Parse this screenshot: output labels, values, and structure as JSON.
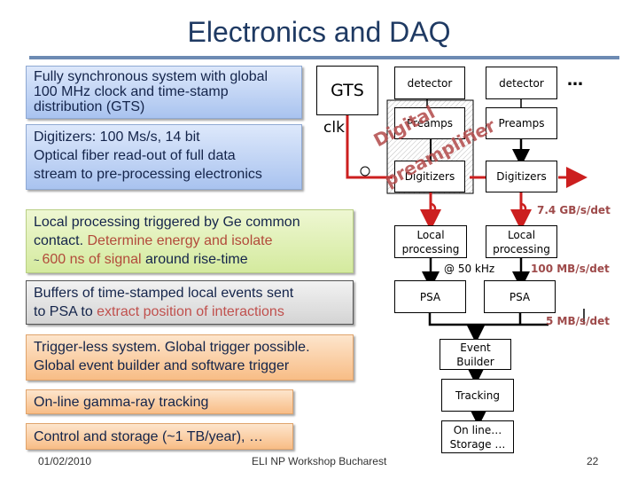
{
  "slide": {
    "title": "Electronics and DAQ",
    "footer_date": "01/02/2010",
    "footer_center": "ELI NP Workshop Bucharest",
    "page_number": "22"
  },
  "text_boxes": [
    {
      "id": "gts",
      "lines": [
        "Fully synchronous system with global",
        "100 MHz clock and time-stamp",
        "distribution (GTS)"
      ]
    },
    {
      "id": "digitizers",
      "lines": [
        "Digitizers: 100 Ms/s,  14 bit",
        "Optical fiber read-out of full data",
        "stream to pre-processing electronics"
      ]
    },
    {
      "id": "local",
      "parts": [
        {
          "text": "Local processing triggered by Ge common",
          "highlight": false
        },
        {
          "text": "contact. ",
          "highlight": false
        },
        {
          "text": "Determine energy and isolate",
          "highlight": true
        },
        {
          "text": "~ ",
          "highlight": false
        },
        {
          "text": "600 ns of signal",
          "highlight": true
        },
        {
          "text": " around rise-time",
          "highlight": false
        }
      ]
    },
    {
      "id": "buffers",
      "parts": [
        {
          "text": "Buffers of time-stamped local events sent",
          "highlight": false
        },
        {
          "text": "to PSA to ",
          "highlight": false
        },
        {
          "text": "extract position of interactions",
          "highlight": true
        }
      ]
    },
    {
      "id": "trigger",
      "lines": [
        "Trigger-less system. Global trigger possible.",
        "Global event builder and software trigger"
      ]
    },
    {
      "id": "tracking",
      "lines": [
        "On-line gamma-ray tracking"
      ]
    },
    {
      "id": "control",
      "lines": [
        "Control and storage (~1 TB/year), …"
      ]
    }
  ],
  "diagram": {
    "gts_label": "GTS",
    "clk_label": "clk",
    "detector_label": "detector",
    "preamps_label": "Preamps",
    "digitizers_label": "Digitizers",
    "local_processing_label": [
      "Local",
      "processing"
    ],
    "psa_label": "PSA",
    "event_builder_label": [
      "Event",
      "Builder"
    ],
    "tracking_label": "Tracking",
    "online_storage_label": [
      "On line…",
      "Storage …"
    ],
    "ellipsis": "…",
    "digital_preamp_label": [
      "Digital",
      "preamplifier"
    ],
    "rate_digitizer": "7.4 GB/s/det",
    "rate_trigger": "@ 50 kHz",
    "rate_local": "100 MB/s/det",
    "rate_psa": "5 MB/s/det",
    "accent_red": "#cc1f1f",
    "rate_color": "#9e4a4a"
  }
}
